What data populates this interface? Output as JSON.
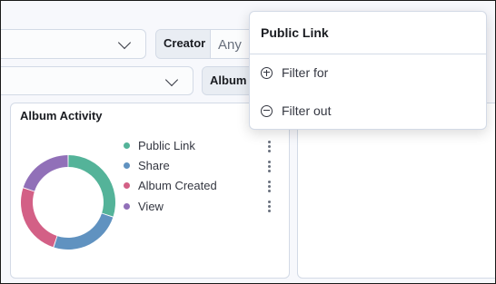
{
  "filters": {
    "creator_label": "Creator",
    "creator_value": "Any",
    "album_label": "Album"
  },
  "panel": {
    "title": "Album Activity",
    "legend": [
      {
        "label": "Public Link",
        "color": "#54b399"
      },
      {
        "label": "Share",
        "color": "#6092c0"
      },
      {
        "label": "Album Created",
        "color": "#d36086"
      },
      {
        "label": "View",
        "color": "#9170b8"
      }
    ]
  },
  "chart_data": {
    "type": "pie",
    "title": "Album Activity",
    "categories": [
      "Public Link",
      "Share",
      "Album Created",
      "View"
    ],
    "values": [
      30,
      25,
      25,
      20
    ],
    "donut": true
  },
  "popover": {
    "title": "Public Link",
    "items": [
      {
        "label": "Filter for",
        "icon": "plus-circle-icon"
      },
      {
        "label": "Filter out",
        "icon": "minus-circle-icon"
      }
    ]
  },
  "colors": {
    "accent_green": "#54b399",
    "accent_blue": "#6092c0",
    "accent_pink": "#d36086",
    "accent_purple": "#9170b8"
  }
}
